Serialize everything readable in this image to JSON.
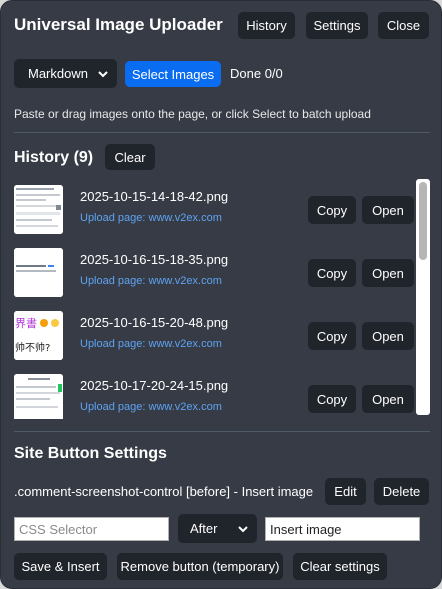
{
  "header": {
    "title": "Universal Image Uploader",
    "history_label": "History",
    "settings_label": "Settings",
    "close_label": "Close"
  },
  "controls": {
    "format_selected": "Markdown",
    "select_images_label": "Select Images",
    "status": "Done 0/0",
    "hint": "Paste or drag images onto the page, or click Select to batch upload"
  },
  "history": {
    "title": "History (9)",
    "clear_label": "Clear",
    "items": [
      {
        "filename": "2025-10-15-14-18-42.png",
        "page": "Upload page: www.v2ex.com",
        "copy": "Copy",
        "open": "Open"
      },
      {
        "filename": "2025-10-16-15-18-35.png",
        "page": "Upload page: www.v2ex.com",
        "copy": "Copy",
        "open": "Open"
      },
      {
        "filename": "2025-10-16-15-20-48.png",
        "page": "Upload page: www.v2ex.com",
        "copy": "Copy",
        "open": "Open"
      },
      {
        "filename": "2025-10-17-20-24-15.png",
        "page": "Upload page: www.v2ex.com",
        "copy": "Copy",
        "open": "Open"
      }
    ],
    "thumb3_text": "界書",
    "thumb3_text2": "帅不帅?"
  },
  "site_settings": {
    "title": "Site Button Settings",
    "rule": ".comment-screenshot-control [before] - Insert image",
    "edit_label": "Edit",
    "delete_label": "Delete",
    "selector_placeholder": "CSS Selector",
    "position_selected": "After",
    "button_text_value": "Insert image",
    "save_insert_label": "Save & Insert",
    "remove_button_label": "Remove button (temporary)",
    "clear_settings_label": "Clear settings"
  },
  "colors": {
    "panel_bg": "#363b45",
    "button_bg": "#20242b",
    "accent": "#0a6cf0",
    "link": "#5ea3f2"
  }
}
